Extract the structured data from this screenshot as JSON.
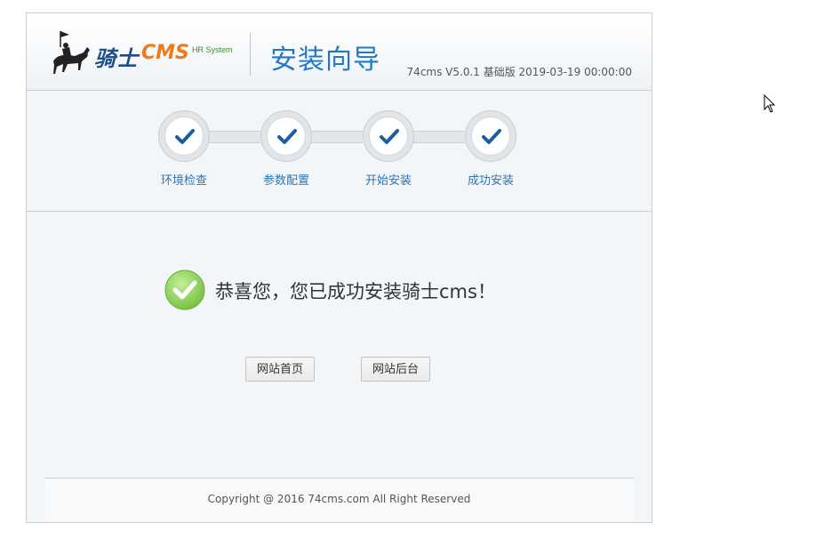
{
  "header": {
    "logo_cn": "骑士",
    "logo_cms": "CMS",
    "logo_hr": "HR System",
    "title": "安装向导",
    "version": "74cms V5.0.1 基础版 2019-03-19 00:00:00"
  },
  "steps": [
    {
      "label": "环境检查",
      "status": "done"
    },
    {
      "label": "参数配置",
      "status": "done"
    },
    {
      "label": "开始安装",
      "status": "done"
    },
    {
      "label": "成功安装",
      "status": "done"
    }
  ],
  "main": {
    "success_message": "恭喜您，您已成功安装骑士cms！",
    "buttons": {
      "home": "网站首页",
      "admin": "网站后台"
    }
  },
  "footer": {
    "copyright": "Copyright @ 2016 74cms.com All Right Reserved"
  },
  "colors": {
    "accent": "#2079c7",
    "check": "#1a5fa3",
    "success": "#8fd15f",
    "logo_orange": "#f07a1a"
  },
  "icons": {
    "logo": "knight-on-horse-icon",
    "step": "checkmark-icon",
    "success": "success-check-icon",
    "cursor": "mouse-pointer-icon"
  }
}
